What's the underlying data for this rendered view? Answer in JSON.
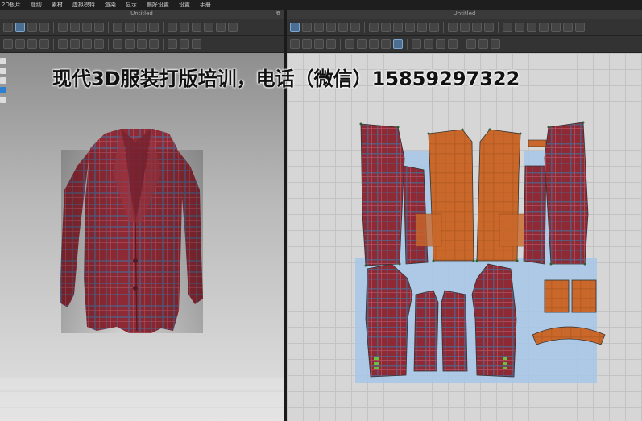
{
  "menubar": {
    "items": [
      "2D板片",
      "缝纫",
      "素材",
      "虚拟模特",
      "渲染",
      "显示",
      "偏好设置",
      "设置",
      "手册"
    ]
  },
  "window_3d": {
    "title": "Untitled"
  },
  "window_2d": {
    "title": "Untitled"
  },
  "overlay": {
    "text": "现代3D服装打版培训，电话（微信）15859297322"
  },
  "colors": {
    "plaid_red": "#8f2a35",
    "plaid_line": "#5c5a7a",
    "selected_orange": "#c9682a",
    "highlight_blue": "#a7c7e8"
  },
  "icons": {
    "left_toolbar": [
      "select-icon",
      "transform-icon",
      "segment-icon",
      "edit-point-icon",
      "curve-icon",
      "sew-icon",
      "pin-icon",
      "fold-icon",
      "measure-icon",
      "avatar-icon"
    ],
    "right_toolbar": [
      "select-icon",
      "transform-icon",
      "edit-point-icon",
      "curve-point-icon",
      "rectangle-icon",
      "circle-icon",
      "polygon-icon",
      "internal-line-icon",
      "dart-icon",
      "notch-icon",
      "seam-icon",
      "sewing-icon",
      "button-icon",
      "topstitch-icon"
    ]
  }
}
